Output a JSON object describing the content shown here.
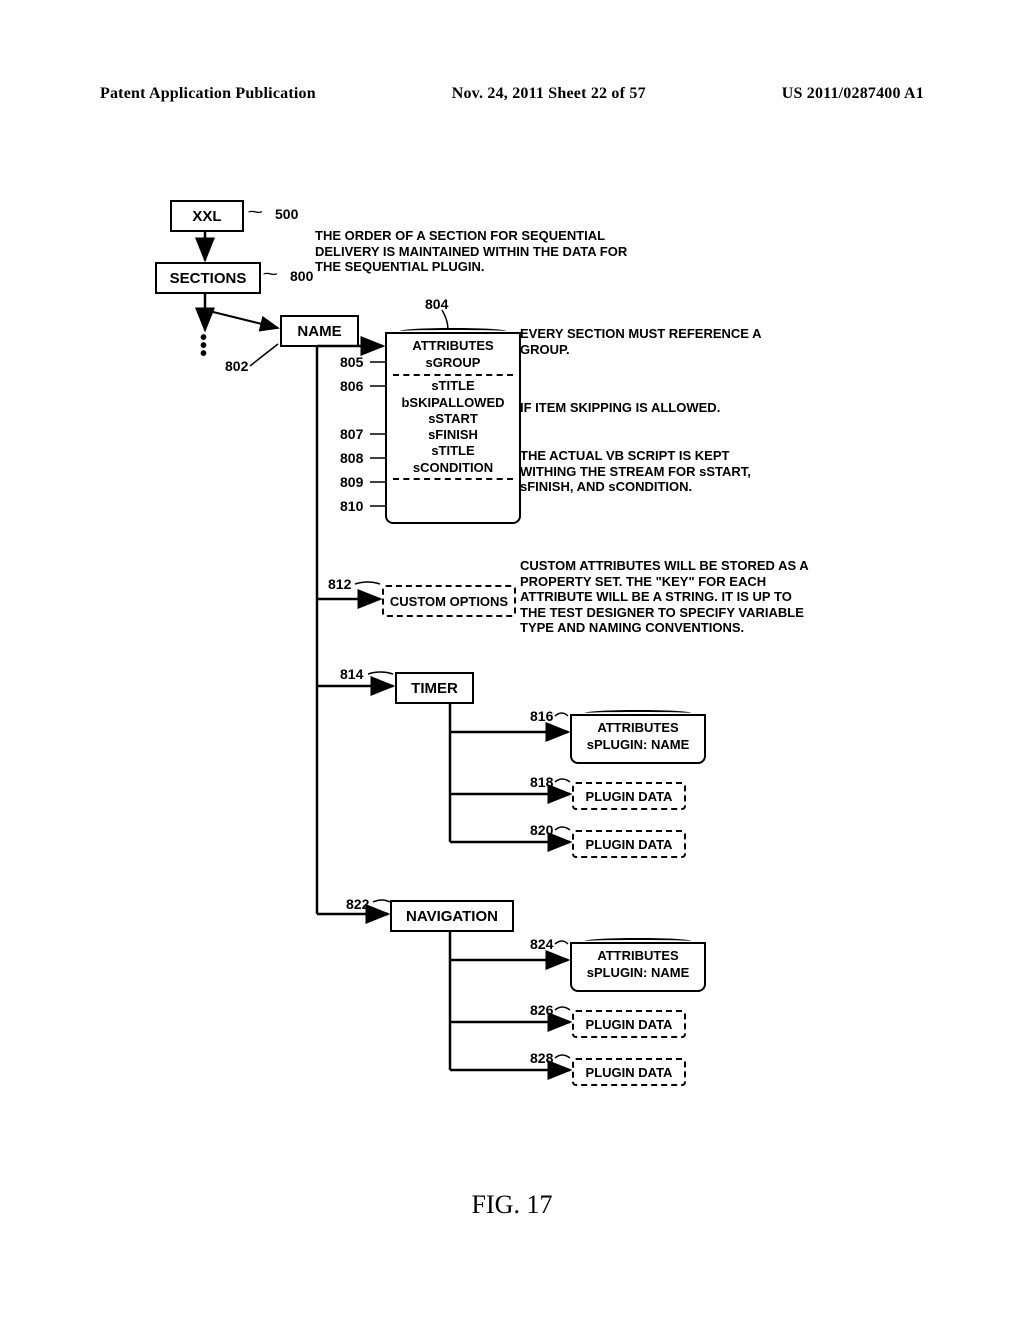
{
  "header": {
    "left": "Patent Application Publication",
    "center": "Nov. 24, 2011  Sheet 22 of 57",
    "right": "US 2011/0287400 A1"
  },
  "refs": {
    "r500": "500",
    "r800": "800",
    "r802": "802",
    "r804": "804",
    "r805": "805",
    "r806": "806",
    "r807": "807",
    "r808": "808",
    "r809": "809",
    "r810": "810",
    "r812": "812",
    "r814": "814",
    "r816": "816",
    "r818": "818",
    "r820": "820",
    "r822": "822",
    "r824": "824",
    "r826": "826",
    "r828": "828"
  },
  "boxes": {
    "xxl": "XXL",
    "sections": "SECTIONS",
    "name": "NAME",
    "timer": "TIMER",
    "navigation": "NAVIGATION",
    "custom_options": "CUSTOM OPTIONS",
    "plugin_data": "PLUGIN DATA"
  },
  "attrs": {
    "title": "ATTRIBUTES",
    "sgroup": "sGROUP",
    "stitle": "sTITLE",
    "bskip": "bSKIPALLOWED",
    "sstart": "sSTART",
    "sfinish": "sFINISH",
    "stitle2": "sTITLE",
    "scond": "sCONDITION",
    "splugin": "sPLUGIN: NAME"
  },
  "annotations": {
    "order": "THE ORDER OF A SECTION FOR SEQUENTIAL DELIVERY IS MAINTAINED WITHIN THE DATA FOR THE SEQUENTIAL PLUGIN.",
    "every_section": "EVERY SECTION MUST REFERENCE A GROUP.",
    "skip": "IF ITEM SKIPPING IS ALLOWED.",
    "vbscript": "THE ACTUAL VB SCRIPT IS KEPT WITHING THE STREAM FOR sSTART, sFINISH, AND sCONDITION.",
    "custom_attrs": "CUSTOM ATTRIBUTES WILL BE STORED AS A PROPERTY SET. THE \"KEY\" FOR EACH ATTRIBUTE WILL BE A STRING.  IT IS UP TO THE TEST DESIGNER TO SPECIFY VARIABLE TYPE AND NAMING CONVENTIONS."
  },
  "figure_caption": "FIG. 17"
}
